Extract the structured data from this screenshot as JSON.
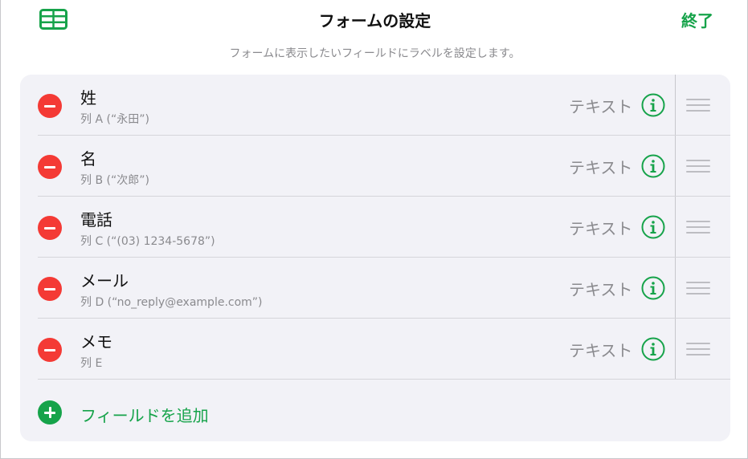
{
  "header": {
    "title": "フォームの設定",
    "done_label": "終了",
    "subtitle": "フォームに表示したいフィールドにラベルを設定します。",
    "table_icon": "table-icon"
  },
  "fields": [
    {
      "name": "姓",
      "sub": "列 A (“永田”)",
      "type": "テキスト"
    },
    {
      "name": "名",
      "sub": "列 B (“次郎”)",
      "type": "テキスト"
    },
    {
      "name": "電話",
      "sub": "列 C (“(03) 1234-5678”)",
      "type": "テキスト"
    },
    {
      "name": "メール",
      "sub": "列 D (“no_reply@example.com”)",
      "type": "テキスト"
    },
    {
      "name": "メモ",
      "sub": "列 E",
      "type": "テキスト"
    }
  ],
  "add_field": {
    "label": "フィールドを追加"
  },
  "colors": {
    "accent": "#16a34a",
    "delete": "#f43a35",
    "card_bg": "#f2f2f7",
    "secondary_text": "#8a8a8e"
  }
}
